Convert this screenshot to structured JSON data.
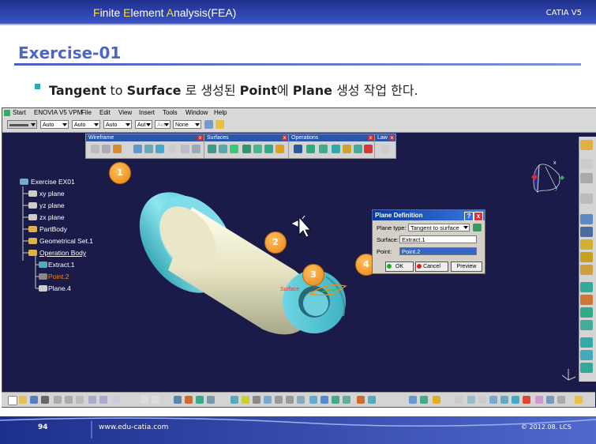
{
  "header": {
    "title_parts": [
      "F",
      "inite ",
      "E",
      "lement ",
      "A",
      "nalysis(FEA)"
    ],
    "brand": "CATIA V5"
  },
  "slide": {
    "exercise_title": "Exercise-01",
    "subtitle_parts": [
      "Tangent",
      " to ",
      "Surface",
      " 로 생성된 ",
      "Point",
      "에 ",
      "Plane",
      " 생성 작업 한다."
    ]
  },
  "catia": {
    "menu": [
      "Start",
      "ENOVIA V5 VPM",
      "File",
      "Edit",
      "View",
      "Insert",
      "Tools",
      "Window",
      "Help"
    ],
    "properties": [
      "Auto",
      "Auto",
      "Auto",
      "Aut",
      "Aut",
      "None"
    ],
    "toolbars": [
      "Wireframe",
      "Surfaces",
      "Operations",
      "Law"
    ],
    "tree": {
      "root": "Exercise EX01",
      "items": [
        "xy plane",
        "yz plane",
        "zx plane",
        "PartBody",
        "Geometrical Set.1",
        "Operation Body",
        "Extract.1",
        "Point.2",
        "Plane.4"
      ]
    },
    "surface_label": "Surface",
    "badges": [
      "1",
      "2",
      "3",
      "4"
    ],
    "dialog": {
      "title": "Plane Definition",
      "plane_type_label": "Plane type:",
      "plane_type_value": "Tangent to surface",
      "surface_label": "Surface:",
      "surface_value": "Extract.1",
      "point_label": "Point:",
      "point_value": "Point.2",
      "ok": "OK",
      "cancel": "Cancel",
      "preview": "Preview"
    },
    "colors": {
      "background": "#1b1b4a",
      "shaft": "#ecebcc",
      "flange": "#6fd3e0",
      "selection": "#ff8a00"
    }
  },
  "footer": {
    "page_number": "94",
    "website": "www.edu-catia.com",
    "copyright": "© 2012.08. LCS"
  }
}
